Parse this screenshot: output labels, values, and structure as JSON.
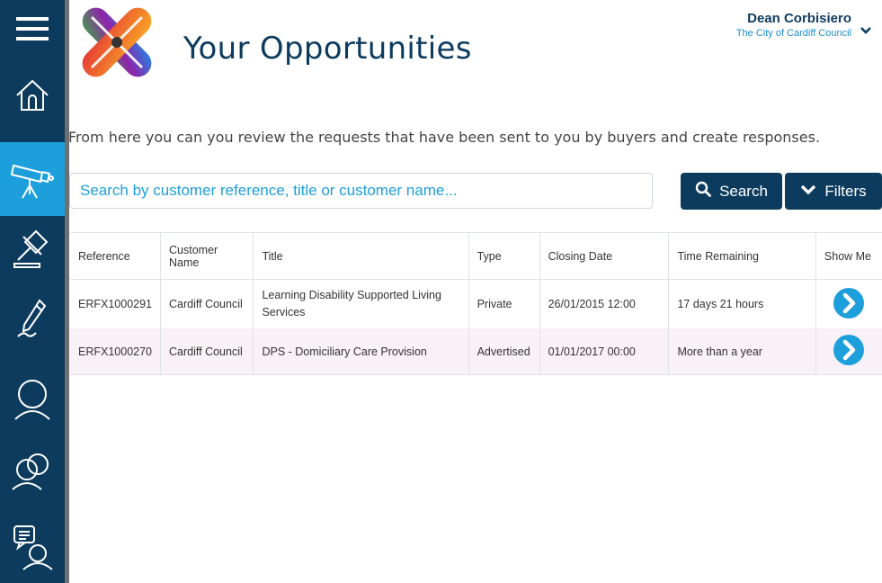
{
  "header": {
    "title": "Your Opportunities",
    "user_name": "Dean Corbisiero",
    "organisation": "The City of Cardiff Council"
  },
  "sidebar": {
    "items": [
      {
        "icon": "menu-icon"
      },
      {
        "icon": "home-icon"
      },
      {
        "icon": "telescope-icon",
        "active": true
      },
      {
        "icon": "gavel-icon"
      },
      {
        "icon": "pen-icon"
      },
      {
        "icon": "person-icon"
      },
      {
        "icon": "people-icon"
      },
      {
        "icon": "chat-person-icon"
      }
    ]
  },
  "intro_text": "From here you can you review the requests that have been sent to you by buyers and create responses.",
  "search": {
    "placeholder": "Search by customer reference, title or customer name...",
    "search_label": "Search",
    "filters_label": "Filters"
  },
  "table": {
    "headers": {
      "reference": "Reference",
      "customer_name": "Customer Name",
      "title": "Title",
      "type": "Type",
      "closing_date": "Closing Date",
      "time_remaining": "Time Remaining",
      "show_me": "Show Me"
    },
    "rows": [
      {
        "reference": "ERFX1000291",
        "customer_name": "Cardiff Council",
        "title": "Learning Disability Supported Living Services",
        "type": "Private",
        "closing_date": "26/01/2015 12:00",
        "time_remaining": "17 days 21 hours"
      },
      {
        "reference": "ERFX1000270",
        "customer_name": "Cardiff Council",
        "title": "DPS - Domiciliary Care Provision",
        "type": "Advertised",
        "closing_date": "01/01/2017 00:00",
        "time_remaining": "More than a year"
      }
    ]
  },
  "colors": {
    "navy": "#0d3b5e",
    "accent_blue": "#1d9fdc",
    "row_alt": "#f8f1f7"
  }
}
